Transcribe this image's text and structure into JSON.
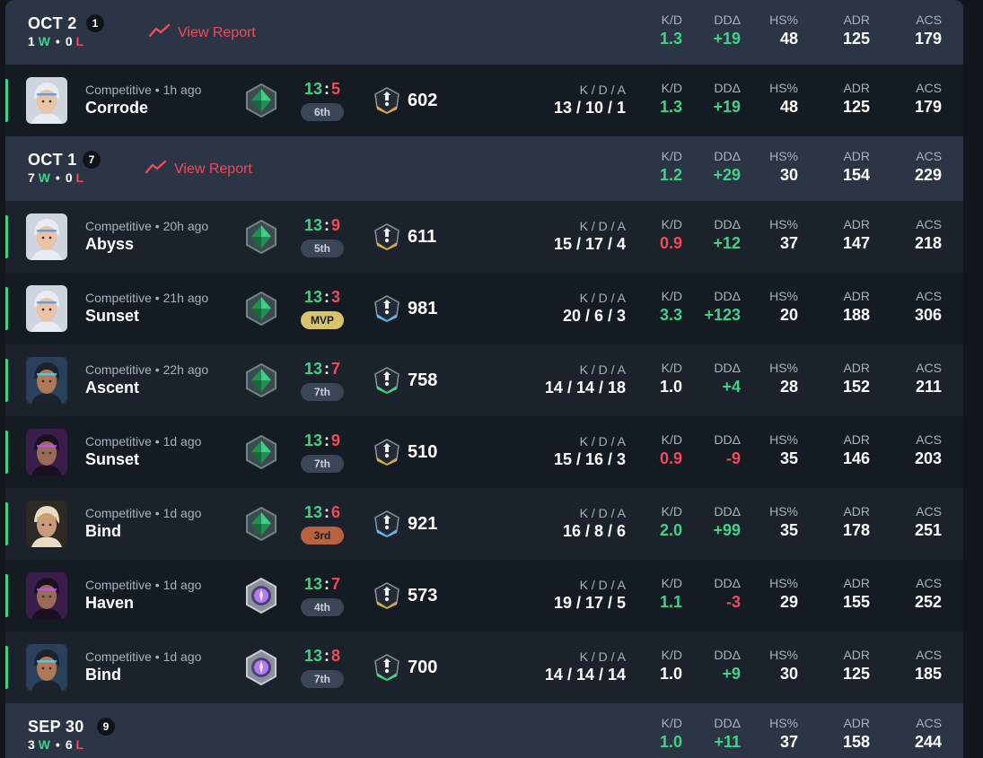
{
  "colors": {
    "win": "#3fd386",
    "loss": "#ef4b5a",
    "header_bg": "#2b3545",
    "row_bg": "#151b23",
    "row_alt_bg": "#1b222c"
  },
  "labels": {
    "kda": "K / D / A",
    "kd": "K/D",
    "dd": "DDΔ",
    "hs": "HS%",
    "adr": "ADR",
    "acs": "ACS",
    "view_report": "View Report",
    "w": "W",
    "l": "L",
    "dot": "•",
    "colon": ":"
  },
  "days": [
    {
      "title": "OCT 2",
      "count": "1",
      "wins": "1",
      "losses": "0",
      "has_report": true,
      "stats": {
        "kd": "1.3",
        "dd": "+19",
        "hs": "48",
        "adr": "125",
        "acs": "179"
      },
      "matches": [
        {
          "queue": "Competitive • 1h ago",
          "map": "Corrode",
          "agent": "jett-portrait-icon",
          "rank": "emerald-rank-icon",
          "score_us": "13",
          "score_them": "5",
          "place": "6th",
          "rr_icon": "gold-chevron-icon",
          "rr": "602",
          "kda": "13 / 10 / 1",
          "kd": "1.3",
          "dd": "+19",
          "hs": "48",
          "adr": "125",
          "acs": "179"
        }
      ]
    },
    {
      "title": "OCT 1",
      "count": "7",
      "wins": "7",
      "losses": "0",
      "has_report": true,
      "stats": {
        "kd": "1.2",
        "dd": "+29",
        "hs": "30",
        "adr": "154",
        "acs": "229"
      },
      "matches": [
        {
          "queue": "Competitive • 20h ago",
          "map": "Abyss",
          "agent": "jett-portrait-icon",
          "rank": "emerald-rank-icon",
          "score_us": "13",
          "score_them": "9",
          "place": "5th",
          "rr_icon": "gold-chevron-icon",
          "rr": "611",
          "kda": "15 / 17 / 4",
          "kd": "0.9",
          "dd": "+12",
          "hs": "37",
          "adr": "147",
          "acs": "218"
        },
        {
          "queue": "Competitive • 21h ago",
          "map": "Sunset",
          "agent": "jett-portrait-icon",
          "rank": "emerald-rank-icon",
          "score_us": "13",
          "score_them": "3",
          "place": "MVP",
          "rr_icon": "blue-chevron-icon",
          "rr": "981",
          "kda": "20 / 6 / 3",
          "kd": "3.3",
          "dd": "+123",
          "hs": "20",
          "adr": "188",
          "acs": "306"
        },
        {
          "queue": "Competitive • 22h ago",
          "map": "Ascent",
          "agent": "neon-portrait-icon",
          "rank": "emerald-rank-icon",
          "score_us": "13",
          "score_them": "7",
          "place": "7th",
          "rr_icon": "green-chevron-icon",
          "rr": "758",
          "kda": "14 / 14 / 18",
          "kd": "1.0",
          "dd": "+4",
          "hs": "28",
          "adr": "152",
          "acs": "211"
        },
        {
          "queue": "Competitive • 1d ago",
          "map": "Sunset",
          "agent": "reyna-portrait-icon",
          "rank": "emerald-rank-icon",
          "score_us": "13",
          "score_them": "9",
          "place": "7th",
          "rr_icon": "gold-chevron-icon",
          "rr": "510",
          "kda": "15 / 16 / 3",
          "kd": "0.9",
          "dd": "-9",
          "hs": "35",
          "adr": "146",
          "acs": "203"
        },
        {
          "queue": "Competitive • 1d ago",
          "map": "Bind",
          "agent": "chamber-portrait-icon",
          "rank": "emerald-rank-icon",
          "score_us": "13",
          "score_them": "6",
          "place": "3rd",
          "rr_icon": "blue-chevron-icon",
          "rr": "921",
          "kda": "16 / 8 / 6",
          "kd": "2.0",
          "dd": "+99",
          "hs": "35",
          "adr": "178",
          "acs": "251"
        },
        {
          "queue": "Competitive • 1d ago",
          "map": "Haven",
          "agent": "reyna-portrait-icon",
          "rank": "platinum-rank-icon",
          "score_us": "13",
          "score_them": "7",
          "place": "4th",
          "rr_icon": "gold-chevron-icon",
          "rr": "573",
          "kda": "19 / 17 / 5",
          "kd": "1.1",
          "dd": "-3",
          "hs": "29",
          "adr": "155",
          "acs": "252"
        },
        {
          "queue": "Competitive • 1d ago",
          "map": "Bind",
          "agent": "neon-portrait-icon",
          "rank": "platinum-rank-icon",
          "score_us": "13",
          "score_them": "8",
          "place": "7th",
          "rr_icon": "green-chevron-icon",
          "rr": "700",
          "kda": "14 / 14 / 14",
          "kd": "1.0",
          "dd": "+9",
          "hs": "30",
          "adr": "125",
          "acs": "185"
        }
      ]
    },
    {
      "title": "SEP 30",
      "count": "9",
      "wins": "3",
      "losses": "6",
      "has_report": false,
      "stats": {
        "kd": "1.0",
        "dd": "+11",
        "hs": "37",
        "adr": "158",
        "acs": "244"
      },
      "matches": []
    }
  ]
}
